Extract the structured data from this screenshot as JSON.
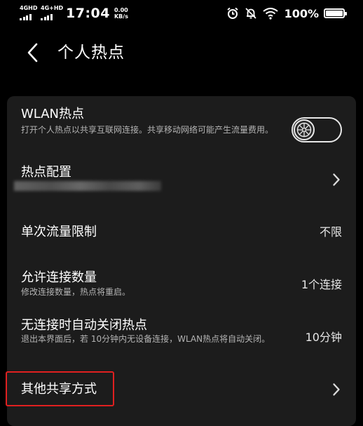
{
  "status_bar": {
    "net1": "4GHD",
    "net2": "4G+HD",
    "time": "17:04",
    "speed_value": "0.00",
    "speed_unit": "KB/s",
    "battery_pct": "100%",
    "icons": [
      "alarm-icon",
      "mute-icon",
      "wifi-icon",
      "battery-icon"
    ]
  },
  "header": {
    "title": "个人热点"
  },
  "settings": {
    "wlan_hotspot": {
      "title": "WLAN热点",
      "subtitle": "打开个人热点以共享互联网连接。共享移动网络可能产生流量费用。",
      "toggle_on": false
    },
    "hotspot_config": {
      "title": "热点配置"
    },
    "data_limit": {
      "title": "单次流量限制",
      "value": "不限"
    },
    "connection_count": {
      "title": "允许连接数量",
      "subtitle": "修改连接数量，热点将重启。",
      "value": "1个连接"
    },
    "auto_off": {
      "title": "无连接时自动关闭热点",
      "subtitle": "退出本界面后，若 10分钟内无设备连接，WLAN热点将自动关闭。",
      "value": "10分钟"
    },
    "other_sharing": {
      "title": "其他共享方式"
    }
  },
  "colors": {
    "background": "#000000",
    "card": "#1c1c1c",
    "highlight": "#e02020"
  }
}
